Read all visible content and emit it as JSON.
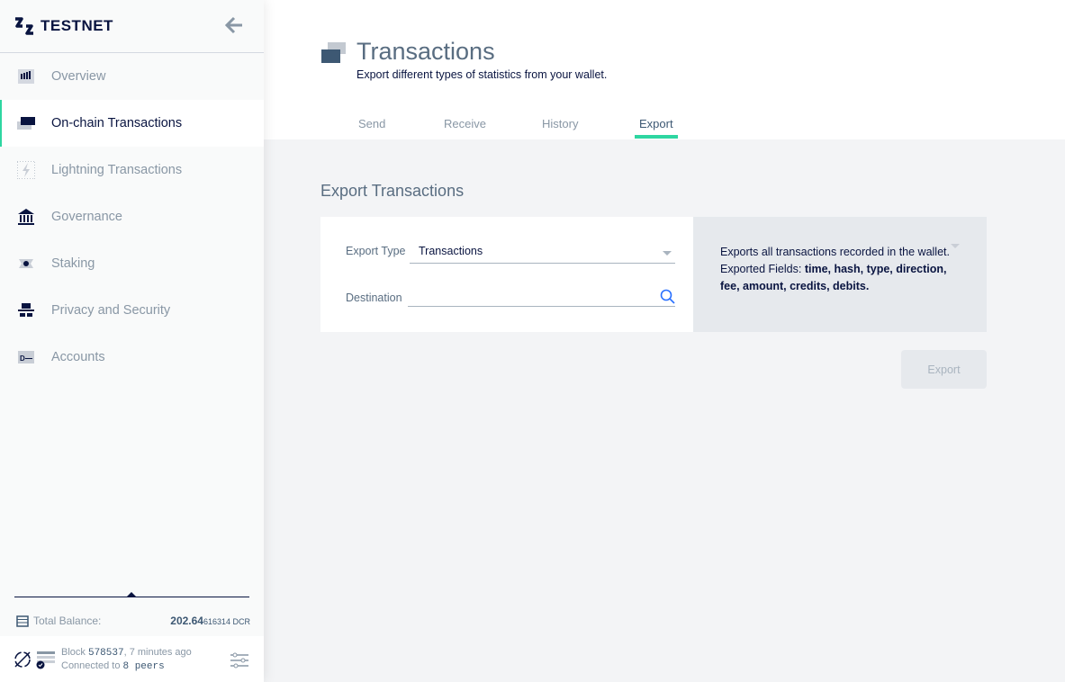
{
  "sidebar": {
    "network": "TESTNET",
    "items": [
      {
        "label": "Overview",
        "icon": "overview-icon"
      },
      {
        "label": "On-chain Transactions",
        "icon": "transactions-icon",
        "active": true
      },
      {
        "label": "Lightning Transactions",
        "icon": "lightning-icon"
      },
      {
        "label": "Governance",
        "icon": "governance-icon"
      },
      {
        "label": "Staking",
        "icon": "ticket-icon"
      },
      {
        "label": "Privacy and Security",
        "icon": "privacy-icon"
      },
      {
        "label": "Accounts",
        "icon": "accounts-icon"
      }
    ],
    "balance_label": "Total Balance:",
    "balance_main": "202.64",
    "balance_rest": "616314 DCR",
    "block_label": "Block",
    "block_number": "578537",
    "block_time": ", 7 minutes ago",
    "connected_label": "Connected to",
    "peers": "8 peers"
  },
  "header": {
    "title": "Transactions",
    "subtitle": "Export different types of statistics from your wallet.",
    "tabs": [
      {
        "label": "Send"
      },
      {
        "label": "Receive"
      },
      {
        "label": "History"
      },
      {
        "label": "Export",
        "active": true
      }
    ]
  },
  "main": {
    "section_title": "Export Transactions",
    "export_type_label": "Export Type",
    "export_type_value": "Transactions",
    "destination_label": "Destination",
    "destination_value": "",
    "description": "Exports all transactions recorded in the wallet.",
    "fields_label": "Exported Fields:",
    "fields": "time, hash, type, direction, fee, amount, credits, debits.",
    "export_button": "Export"
  },
  "colors": {
    "accent": "#2ed6a1",
    "navy": "#091440",
    "muted": "#8997a5"
  }
}
